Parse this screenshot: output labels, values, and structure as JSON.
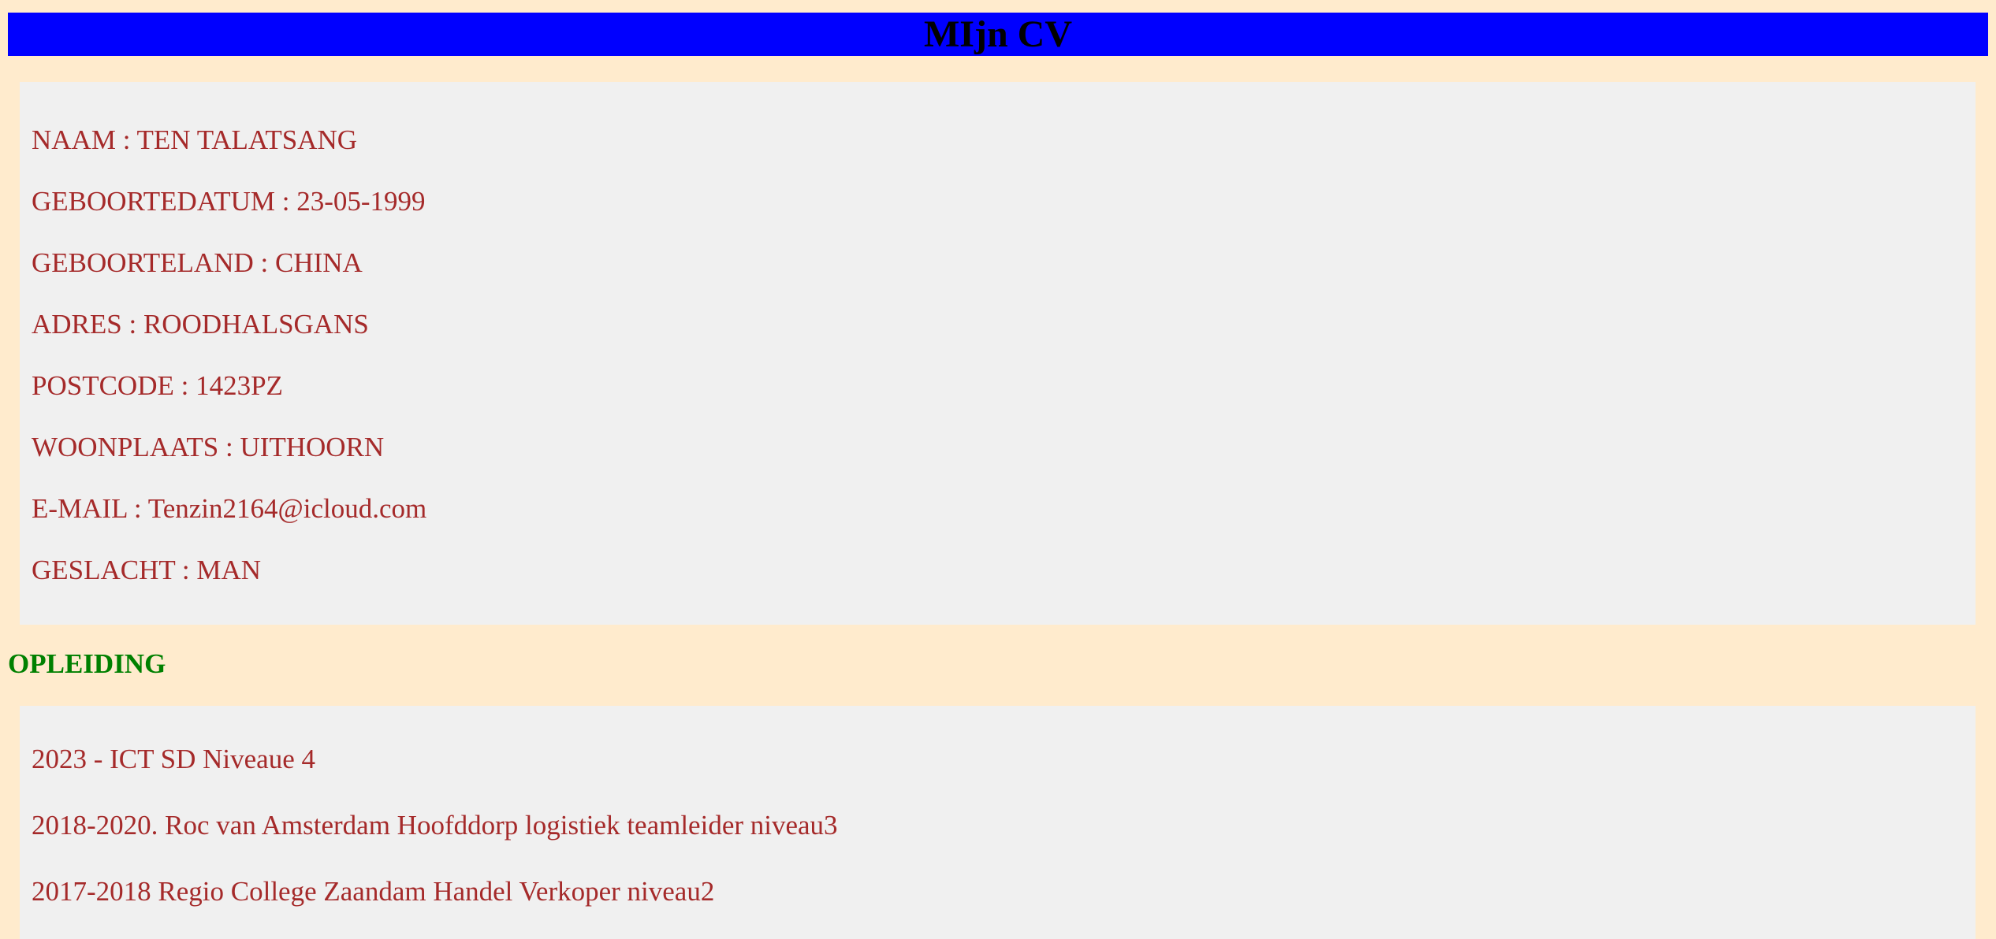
{
  "header": {
    "title": "MIjn CV",
    "bar_color": "#0000ff"
  },
  "personal": {
    "lines": [
      "NAAM : TEN TALATSANG",
      "GEBOORTEDATUM : 23-05-1999",
      "GEBOORTELAND : CHINA",
      "ADRES : ROODHALSGANS",
      "POSTCODE : 1423PZ",
      "WOONPLAATS : UITHOORN",
      "E-MAIL : Tenzin2164@icloud.com",
      "GESLACHT : MAN"
    ]
  },
  "education": {
    "heading": "OPLEIDING",
    "lines": [
      "2023 - ICT SD Niveaue 4",
      "2018-2020. Roc van Amsterdam Hoofddorp logistiek teamleider niveau3",
      "2017-2018 Regio College Zaandam Handel Verkoper niveau2"
    ]
  },
  "colors": {
    "page_background": "#ffebcd",
    "panel_background": "#f0f0f0",
    "text": "#a52a2a",
    "heading": "#008000"
  }
}
